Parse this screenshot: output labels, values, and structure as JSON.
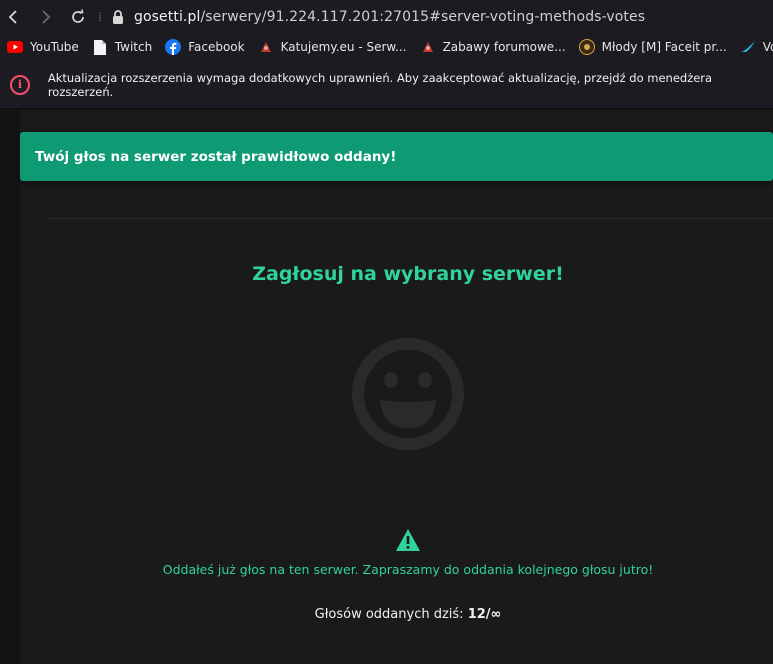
{
  "browser": {
    "url_host": "gosetti.pl",
    "url_path": "/serwery/91.224.117.201:27015#server-voting-methods-votes",
    "bookmarks": [
      {
        "label": "YouTube",
        "icon": "youtube-icon"
      },
      {
        "label": "Twitch",
        "icon": "document-icon"
      },
      {
        "label": "Facebook",
        "icon": "facebook-icon"
      },
      {
        "label": "Katujemy.eu - Serw...",
        "icon": "site-favicon"
      },
      {
        "label": "Zabawy forumowe...",
        "icon": "site-favicon"
      },
      {
        "label": "Młody [M] Faceit pr...",
        "icon": "site-favicon"
      },
      {
        "label": "Voopoo coi",
        "icon": "bird-icon"
      }
    ]
  },
  "infobar": {
    "message": "Aktualizacja rozszerzenia wymaga dodatkowych uprawnień. Aby zaakceptować aktualizację, przejdź do menedżera rozszerzeń.",
    "icon": "info-icon"
  },
  "toast": {
    "message": "Twój głos na serwer został prawidłowo oddany!"
  },
  "voting": {
    "heading": "Zagłosuj na wybrany serwer!",
    "notice": "Oddałeś już głos na ten serwer. Zapraszamy do oddania kolejnego głosu jutro!",
    "votes_label": "Głosów oddanych dziś:",
    "votes_value": "12/∞"
  },
  "colors": {
    "accent": "#2fd39b",
    "toast_bg": "#0e9a72",
    "info_icon": "#ff4f6d"
  }
}
